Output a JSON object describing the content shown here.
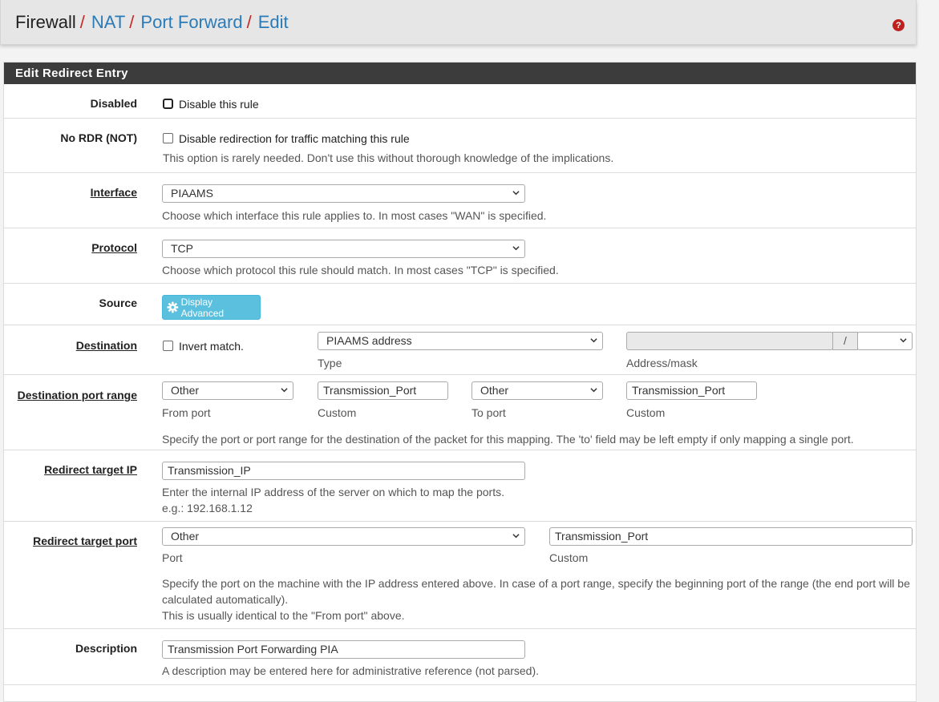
{
  "breadcrumb": {
    "root": "Firewall",
    "items": [
      "NAT",
      "Port Forward",
      "Edit"
    ],
    "separator": "/"
  },
  "panel": {
    "title": "Edit Redirect Entry"
  },
  "disabled": {
    "label": "Disabled",
    "checkbox_text": "Disable this rule",
    "checked": false
  },
  "nordr": {
    "label": "No RDR (NOT)",
    "checkbox_text": "Disable redirection for traffic matching this rule",
    "help": "This option is rarely needed. Don't use this without thorough knowledge of the implications.",
    "checked": false
  },
  "interface": {
    "label": "Interface",
    "value": "PIAAMS",
    "help": "Choose which interface this rule applies to. In most cases \"WAN\" is specified."
  },
  "protocol": {
    "label": "Protocol",
    "value": "TCP",
    "help": "Choose which protocol this rule should match. In most cases \"TCP\" is specified."
  },
  "source": {
    "label": "Source",
    "button": "Display Advanced",
    "button_icon": "gear-icon"
  },
  "destination": {
    "label": "Destination",
    "invert_text": "Invert match.",
    "type_value": "PIAAMS address",
    "type_caption": "Type",
    "address_value": "",
    "slash": "/",
    "mask_value": "",
    "address_caption": "Address/mask"
  },
  "dest_port_range": {
    "label": "Destination port range",
    "from_select": "Other",
    "from_caption": "From port",
    "from_custom": "Transmission_Port",
    "from_custom_caption": "Custom",
    "to_select": "Other",
    "to_caption": "To port",
    "to_custom": "Transmission_Port",
    "to_custom_caption": "Custom",
    "help": "Specify the port or port range for the destination of the packet for this mapping. The 'to' field may be left empty if only mapping a single port."
  },
  "redirect_ip": {
    "label": "Redirect target IP",
    "value": "Transmission_IP",
    "help1": "Enter the internal IP address of the server on which to map the ports.",
    "help2": "e.g.: 192.168.1.12"
  },
  "redirect_port": {
    "label": "Redirect target port",
    "select_value": "Other",
    "select_caption": "Port",
    "custom_value": "Transmission_Port",
    "custom_caption": "Custom",
    "help1": "Specify the port on the machine with the IP address entered above. In case of a port range, specify the beginning port of the range (the end port will be",
    "help2": "calculated automatically).",
    "help3": "This is usually identical to the \"From port\" above."
  },
  "description": {
    "label": "Description",
    "value": "Transmission Port Forwarding PIA",
    "help": "A description may be entered here for administrative reference (not parsed)."
  },
  "colors": {
    "heading_bg": "#3c3c3c",
    "link": "#2a7bb8",
    "separator": "#c62828",
    "info_button": "#5bc0de",
    "help_icon": "#c01f1f"
  }
}
